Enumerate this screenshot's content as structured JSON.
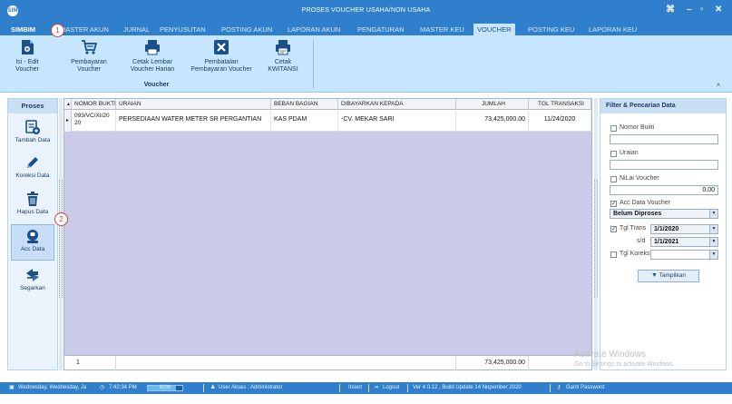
{
  "window": {
    "app_icon_text": "SIM",
    "title": "PROSES VOUCHER USAHA/NON USAHA",
    "controls": {
      "pin": "⌘",
      "minimize": "–",
      "restore": "▫",
      "close": "✕"
    }
  },
  "tabs": [
    {
      "label": "SIMBIM"
    },
    {
      "label": "MASTER AKUN"
    },
    {
      "label": "JURNAL"
    },
    {
      "label": "PENYUSUTAN"
    },
    {
      "label": "POSTING AKUN"
    },
    {
      "label": "LAPORAN AKUN"
    },
    {
      "label": "PENGATURAN"
    },
    {
      "label": "MASTER KEU"
    },
    {
      "label": "VOUCHER"
    },
    {
      "label": "POSTING KEU"
    },
    {
      "label": "LAPORAN KEU"
    }
  ],
  "active_tab": "VOUCHER",
  "ribbon": {
    "buttons": [
      {
        "label": "Isi - Edit\nVoucher",
        "icon": "edit-document-icon"
      },
      {
        "label": "Pembayaran\nVoucher",
        "icon": "cart-icon"
      },
      {
        "label": "Cetak Lembar\nVoucher Harian",
        "icon": "printer-icon"
      },
      {
        "label": "Pembatalan\nPembayaran Voucher",
        "icon": "cancel-box-icon"
      },
      {
        "label": "Cetak\nKWITANSI",
        "icon": "print-receipt-icon"
      }
    ],
    "group_label": "Voucher",
    "collapse_caret": "˄"
  },
  "left_panel": {
    "title": "Proses",
    "items": [
      {
        "label": "Tambah Data",
        "icon": "add-data-icon"
      },
      {
        "label": "Koreksi Data",
        "icon": "pencil-icon"
      },
      {
        "label": "Hapus Data",
        "icon": "trash-icon"
      },
      {
        "label": "Acc Data",
        "icon": "stamp-icon"
      },
      {
        "label": "Segarkan",
        "icon": "refresh-icon"
      }
    ],
    "selected": "Acc Data"
  },
  "grid": {
    "sort_marker": "▲",
    "columns": [
      "NOMOR BUKTI",
      "URAIAN",
      "BEBAN BAGIAN",
      "DIBAYARKAN KEPADA",
      "JUMLAH",
      "TGL TRANSAKSI"
    ],
    "rows": [
      {
        "nomor_bukti": "093/VC/XI/2020",
        "uraian": "PERSEDIAAN WATER METER SR PERGANTIAN",
        "beban_bagian": "KAS PDAM",
        "dibayarkan_kepada": "-CV. MEKAR SARI",
        "jumlah": "73,425,000.00",
        "tgl_transaksi": "11/24/2020"
      }
    ],
    "footer": {
      "count": "1",
      "total": "73,425,000.00"
    }
  },
  "filter_panel": {
    "title": "Filter & Pencarian Data",
    "nomor_bukti": {
      "label": "Nomor Buiiti",
      "checked": false,
      "value": ""
    },
    "uraian": {
      "label": "Uraian",
      "checked": false,
      "value": ""
    },
    "nilai_voucher": {
      "label": "NiLai Voucher",
      "checked": false,
      "value": "0.00"
    },
    "acc_data_voucher": {
      "label": "Acc Data Voucher",
      "checked": true,
      "selected": "Belum Diproses"
    },
    "tgl_trans": {
      "label": "Tgl Trans",
      "checked": true,
      "from": "1/1/2020",
      "to_label": "s/d",
      "to": "1/1/2021"
    },
    "tgl_koreksi": {
      "label": "Tgl Koreksi",
      "checked": false,
      "value": ""
    },
    "show_button": "Tampilkan",
    "check_mark": "✓"
  },
  "watermark": {
    "line1": "Activate Windows",
    "line2": "Go to Settings to activate Windows."
  },
  "status_bar": {
    "date": "Wednesday, Wednesday, Ja",
    "time": "7:42:34 PM",
    "progress_text": "81%",
    "progress": 0.81,
    "user": "User Akses : Administrator",
    "insert": "Insert",
    "logout": "Logout",
    "version": "Ver 4.0.12 , Build Update 14 Nopember 2020",
    "ganti_password": "Ganti Password"
  },
  "callouts": [
    "1",
    "2"
  ],
  "colors": {
    "titlebar": "#2f7fcd",
    "ribbon": "#c6e6ff",
    "grid_empty": "#c9cbe8",
    "callout": "#d5412f"
  }
}
